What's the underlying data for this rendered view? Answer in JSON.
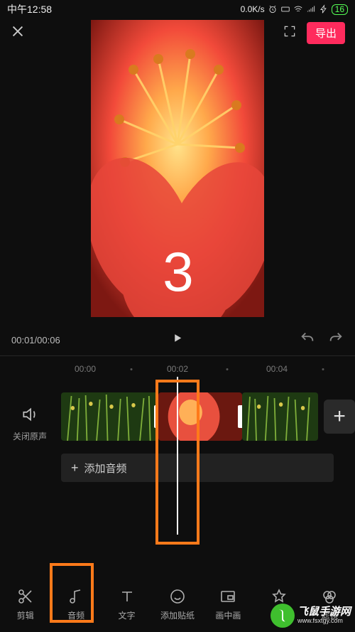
{
  "status": {
    "time": "中午12:58",
    "net": "0.0K/s",
    "battery": "16"
  },
  "topbar": {
    "export_label": "导出"
  },
  "preview": {
    "countdown": "3"
  },
  "playback": {
    "current": "00:01",
    "total": "00:06"
  },
  "ruler": {
    "labels": [
      "00:00",
      "00:02",
      "00:04"
    ]
  },
  "mute": {
    "label": "关闭原声"
  },
  "add_audio": {
    "label": "添加音频"
  },
  "toolbar": {
    "items": [
      {
        "id": "edit",
        "label": "剪辑"
      },
      {
        "id": "audio",
        "label": "音频"
      },
      {
        "id": "text",
        "label": "文字"
      },
      {
        "id": "sticker",
        "label": "添加贴纸"
      },
      {
        "id": "pip",
        "label": "画中画"
      },
      {
        "id": "effect",
        "label": "特效"
      },
      {
        "id": "filter",
        "label": "滤镜"
      }
    ]
  },
  "watermark": {
    "line1": "飞鼠手游网",
    "line2": "www.fsxtgy.com"
  }
}
